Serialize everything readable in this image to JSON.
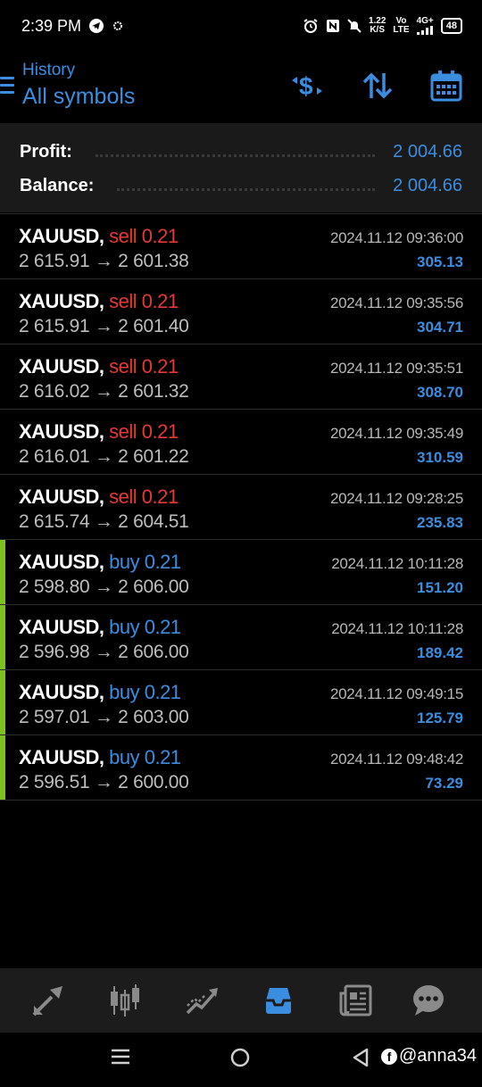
{
  "status_bar": {
    "time": "2:39 PM",
    "speed_value": "1.22",
    "speed_unit": "K/S",
    "volte_top": "Vo",
    "volte_bottom": "LTE",
    "network": "4G+",
    "battery": "48"
  },
  "header": {
    "subtitle": "History",
    "title": "All symbols",
    "accent_color": "#3b8de0"
  },
  "summary": {
    "profit_label": "Profit:",
    "profit_value": "2 004.66",
    "balance_label": "Balance:",
    "balance_value": "2 004.66"
  },
  "trades": [
    {
      "symbol": "XAUUSD,",
      "type": "sell 0.21",
      "side": "sell",
      "open": "2 615.91",
      "close": "2 601.38",
      "time": "2024.11.12 09:36:00",
      "profit": "305.13"
    },
    {
      "symbol": "XAUUSD,",
      "type": "sell 0.21",
      "side": "sell",
      "open": "2 615.91",
      "close": "2 601.40",
      "time": "2024.11.12 09:35:56",
      "profit": "304.71"
    },
    {
      "symbol": "XAUUSD,",
      "type": "sell 0.21",
      "side": "sell",
      "open": "2 616.02",
      "close": "2 601.32",
      "time": "2024.11.12 09:35:51",
      "profit": "308.70"
    },
    {
      "symbol": "XAUUSD,",
      "type": "sell 0.21",
      "side": "sell",
      "open": "2 616.01",
      "close": "2 601.22",
      "time": "2024.11.12 09:35:49",
      "profit": "310.59"
    },
    {
      "symbol": "XAUUSD,",
      "type": "sell 0.21",
      "side": "sell",
      "open": "2 615.74",
      "close": "2 604.51",
      "time": "2024.11.12 09:28:25",
      "profit": "235.83"
    },
    {
      "symbol": "XAUUSD,",
      "type": "buy 0.21",
      "side": "buy",
      "open": "2 598.80",
      "close": "2 606.00",
      "time": "2024.11.12 10:11:28",
      "profit": "151.20"
    },
    {
      "symbol": "XAUUSD,",
      "type": "buy 0.21",
      "side": "buy",
      "open": "2 596.98",
      "close": "2 606.00",
      "time": "2024.11.12 10:11:28",
      "profit": "189.42"
    },
    {
      "symbol": "XAUUSD,",
      "type": "buy 0.21",
      "side": "buy",
      "open": "2 597.01",
      "close": "2 603.00",
      "time": "2024.11.12 09:49:15",
      "profit": "125.79"
    },
    {
      "symbol": "XAUUSD,",
      "type": "buy 0.21",
      "side": "buy",
      "open": "2 596.51",
      "close": "2 600.00",
      "time": "2024.11.12 09:48:42",
      "profit": "73.29"
    }
  ],
  "arrow": "→",
  "bottom_nav": [
    "quotes-icon",
    "chart-icon",
    "trade-icon",
    "history-icon",
    "news-icon",
    "messages-icon"
  ],
  "watermark": "@anna34",
  "watermark_badge": "f"
}
